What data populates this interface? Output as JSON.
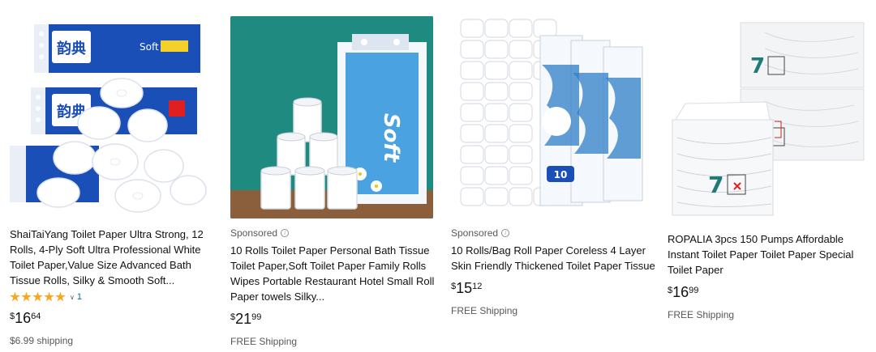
{
  "products": [
    {
      "sponsored": false,
      "title": "ShaiTaiYang Toilet Paper Ultra Strong, 12 Rolls, 4-Ply Soft Ultra Professional White Toilet Paper,Value Size Advanced Bath Tissue Rolls, Silky & Smooth Soft...",
      "rating": 5,
      "rating_count": "1",
      "price": {
        "symbol": "$",
        "whole": "16",
        "fraction": "64"
      },
      "shipping": "$6.99 shipping",
      "package_text": "韵典",
      "package_brand": "Soft"
    },
    {
      "sponsored": true,
      "sponsored_label": "Sponsored",
      "title": "10 Rolls Toilet Paper Personal Bath Tissue Toilet Paper,Soft Toilet Paper Family Rolls Wipes Portable Restaurant Hotel Small Roll Paper towels Silky...",
      "price": {
        "symbol": "$",
        "whole": "21",
        "fraction": "99"
      },
      "shipping": "FREE Shipping",
      "package_text": "Soft"
    },
    {
      "sponsored": true,
      "sponsored_label": "Sponsored",
      "title": "10 Rolls/Bag Roll Paper Coreless 4 Layer Skin Friendly Thickened Toilet Paper Tissue",
      "price": {
        "symbol": "$",
        "whole": "15",
        "fraction": "12"
      },
      "shipping": "FREE Shipping",
      "package_text": "10"
    },
    {
      "sponsored": false,
      "title": "ROPALIA 3pcs 150 Pumps Affordable Instant Toilet Paper Toilet Paper Special Toilet Paper",
      "price": {
        "symbol": "$",
        "whole": "16",
        "fraction": "99"
      },
      "shipping": "FREE Shipping",
      "package_text": "7"
    }
  ],
  "colors": {
    "package_blue": "#1a4fb8",
    "teal_bg": "#1f8a80",
    "star": "#ffa41c",
    "link": "#007185"
  }
}
